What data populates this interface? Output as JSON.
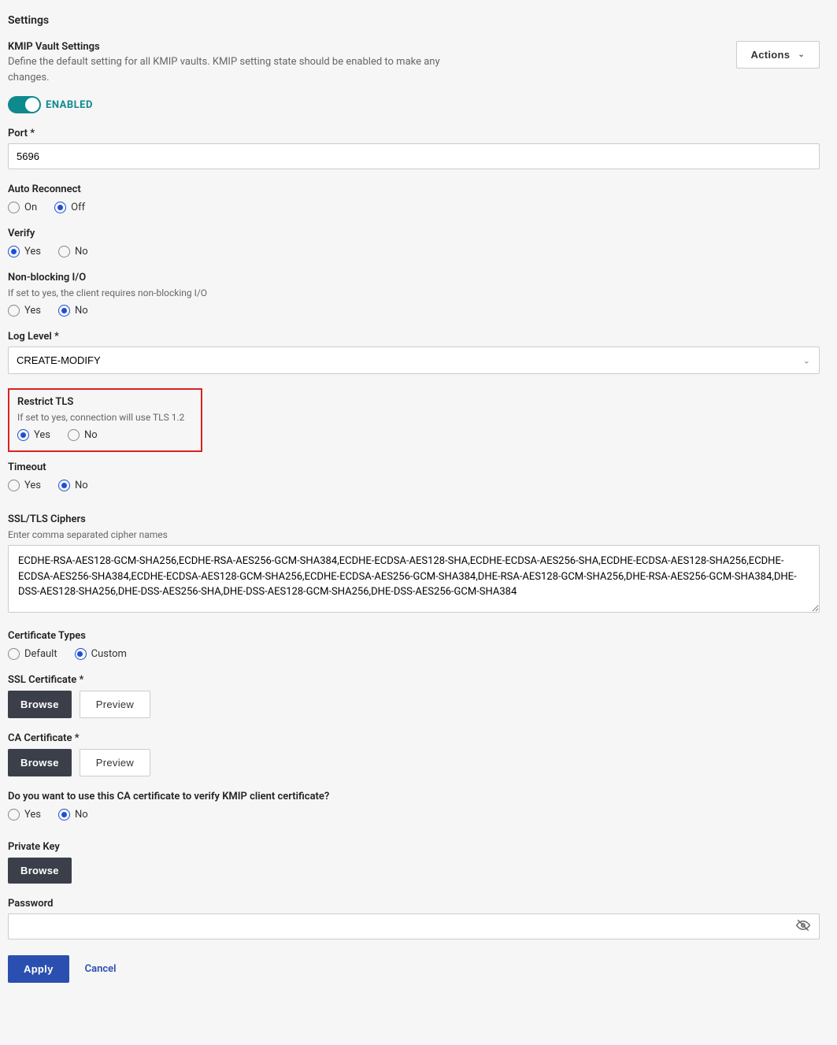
{
  "page_title": "Settings",
  "header": {
    "title": "KMIP Vault Settings",
    "description": "Define the default setting for all KMIP vaults. KMIP setting state should be enabled to make any changes.",
    "actions_label": "Actions"
  },
  "toggle": {
    "label": "ENABLED",
    "checked": true
  },
  "port": {
    "label": "Port",
    "value": "5696"
  },
  "auto_reconnect": {
    "label": "Auto Reconnect",
    "options": {
      "on": "On",
      "off": "Off"
    },
    "selected": "off"
  },
  "verify": {
    "label": "Verify",
    "options": {
      "yes": "Yes",
      "no": "No"
    },
    "selected": "yes"
  },
  "nonblocking": {
    "label": "Non-blocking I/O",
    "help": "If set to yes, the client requires non-blocking I/O",
    "options": {
      "yes": "Yes",
      "no": "No"
    },
    "selected": "no"
  },
  "loglevel": {
    "label": "Log Level",
    "value": "CREATE-MODIFY"
  },
  "restrict_tls": {
    "label": "Restrict TLS",
    "help": "If set to yes, connection will use TLS 1.2",
    "options": {
      "yes": "Yes",
      "no": "No"
    },
    "selected": "yes"
  },
  "timeout": {
    "label": "Timeout",
    "options": {
      "yes": "Yes",
      "no": "No"
    },
    "selected": "no"
  },
  "ciphers": {
    "label": "SSL/TLS Ciphers",
    "help": "Enter comma separated cipher names",
    "value": "ECDHE-RSA-AES128-GCM-SHA256,ECDHE-RSA-AES256-GCM-SHA384,ECDHE-ECDSA-AES128-SHA,ECDHE-ECDSA-AES256-SHA,ECDHE-ECDSA-AES128-SHA256,ECDHE-ECDSA-AES256-SHA384,ECDHE-ECDSA-AES128-GCM-SHA256,ECDHE-ECDSA-AES256-GCM-SHA384,DHE-RSA-AES128-GCM-SHA256,DHE-RSA-AES256-GCM-SHA384,DHE-DSS-AES128-SHA256,DHE-DSS-AES256-SHA,DHE-DSS-AES128-GCM-SHA256,DHE-DSS-AES256-GCM-SHA384"
  },
  "cert_types": {
    "label": "Certificate Types",
    "options": {
      "default": "Default",
      "custom": "Custom"
    },
    "selected": "custom"
  },
  "ssl_cert": {
    "label": "SSL Certificate",
    "browse": "Browse",
    "preview": "Preview"
  },
  "ca_cert": {
    "label": "CA Certificate",
    "browse": "Browse",
    "preview": "Preview"
  },
  "verify_client": {
    "label": "Do you want to use this CA certificate to verify KMIP client certificate?",
    "options": {
      "yes": "Yes",
      "no": "No"
    },
    "selected": "no"
  },
  "private_key": {
    "label": "Private Key",
    "browse": "Browse"
  },
  "password": {
    "label": "Password",
    "value": ""
  },
  "footer": {
    "apply": "Apply",
    "cancel": "Cancel"
  }
}
